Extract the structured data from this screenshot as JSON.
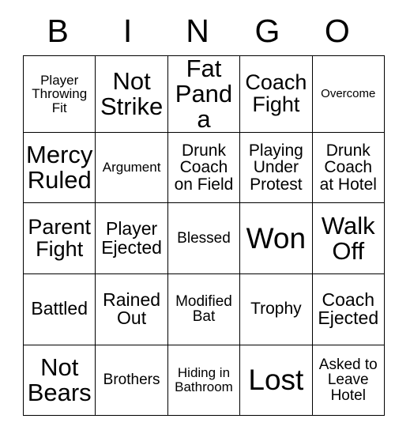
{
  "card": {
    "header": {
      "letters": [
        "B",
        "I",
        "N",
        "G",
        "O"
      ]
    },
    "rows": [
      [
        {
          "text": "Player\nThrowing\nFit",
          "size": "fs-s"
        },
        {
          "text": "Not\nStrike",
          "size": "fs-xxl"
        },
        {
          "text": "Fat\nPanda",
          "size": "fs-xxl"
        },
        {
          "text": "Coach\nFight",
          "size": "fs-xl"
        },
        {
          "text": "Overcome",
          "size": "fs-xs"
        }
      ],
      [
        {
          "text": "Mercy\nRuled",
          "size": "fs-xxl"
        },
        {
          "text": "Argument",
          "size": "fs-s"
        },
        {
          "text": "Drunk\nCoach\non Field",
          "size": "fs-ml"
        },
        {
          "text": "Playing\nUnder\nProtest",
          "size": "fs-ml"
        },
        {
          "text": "Drunk\nCoach\nat Hotel",
          "size": "fs-ml"
        }
      ],
      [
        {
          "text": "Parent\nFight",
          "size": "fs-xl"
        },
        {
          "text": "Player\nEjected",
          "size": "fs-l"
        },
        {
          "text": "Blessed",
          "size": "fs-m"
        },
        {
          "text": "Won",
          "size": "fs-h"
        },
        {
          "text": "Walk\nOff",
          "size": "fs-xxl"
        }
      ],
      [
        {
          "text": "Battled",
          "size": "fs-l"
        },
        {
          "text": "Rained\nOut",
          "size": "fs-l"
        },
        {
          "text": "Modified\nBat",
          "size": "fs-m"
        },
        {
          "text": "Trophy",
          "size": "fs-ml"
        },
        {
          "text": "Coach\nEjected",
          "size": "fs-l"
        }
      ],
      [
        {
          "text": "Not\nBears",
          "size": "fs-xxl"
        },
        {
          "text": "Brothers",
          "size": "fs-m"
        },
        {
          "text": "Hiding in\nBathroom",
          "size": "fs-s"
        },
        {
          "text": "Lost",
          "size": "fs-h"
        },
        {
          "text": "Asked to\nLeave\nHotel",
          "size": "fs-m"
        }
      ]
    ]
  },
  "colors": {
    "border": "#000000",
    "text": "#000000",
    "background": "#ffffff"
  }
}
